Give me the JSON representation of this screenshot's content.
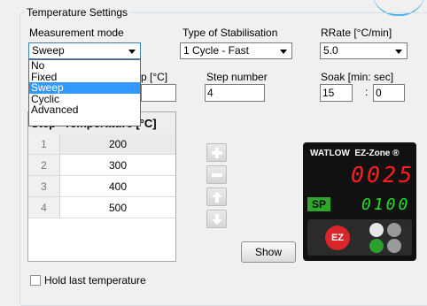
{
  "group": {
    "title": "Temperature Settings"
  },
  "measurement_mode": {
    "label": "Measurement mode",
    "selected": "Sweep",
    "options": [
      "No",
      "Fixed",
      "Sweep",
      "Cyclic",
      "Advanced"
    ]
  },
  "stabilisation": {
    "label": "Type of Stabilisation",
    "selected": "1 Cycle - Fast"
  },
  "rrate": {
    "label": "RRate [°C/min]",
    "selected": "5.0"
  },
  "step": {
    "label_partial": "p [°C]",
    "value": ""
  },
  "step_number": {
    "label": "Step number",
    "value": "4"
  },
  "soak": {
    "label": "Soak [min: sec]",
    "min": "15",
    "sec": "0",
    "separator": ":"
  },
  "table": {
    "header_step": "Step",
    "header_temp": "Temperature [°C]",
    "rows": [
      {
        "n": "1",
        "temp": "200"
      },
      {
        "n": "2",
        "temp": "300"
      },
      {
        "n": "3",
        "temp": "400"
      },
      {
        "n": "4",
        "temp": "500"
      }
    ]
  },
  "show_button": "Show",
  "controller": {
    "brand": "WATLOW",
    "model": "EZ-Zone ®",
    "pv": "0025",
    "sp_label": "SP",
    "sp_value": "0100",
    "ez_label": "EZ"
  },
  "hold_last": {
    "label": "Hold last temperature",
    "checked": false
  },
  "colors": {
    "accent": "#3399ff",
    "led_red": "#ff1e1e",
    "led_green": "#22e022"
  }
}
